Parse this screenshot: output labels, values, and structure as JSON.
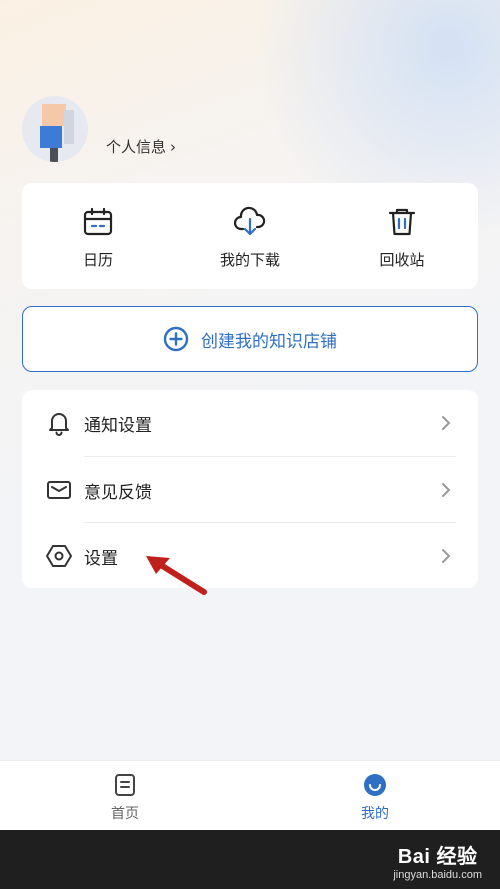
{
  "profile": {
    "info_label": "个人信息",
    "chevron": "›"
  },
  "quick_actions": [
    {
      "label": "日历",
      "icon": "calendar-icon"
    },
    {
      "label": "我的下载",
      "icon": "cloud-download-icon"
    },
    {
      "label": "回收站",
      "icon": "trash-icon"
    }
  ],
  "create_store": {
    "label": "创建我的知识店铺",
    "icon": "plus-circle-icon"
  },
  "settings_list": [
    {
      "label": "通知设置",
      "icon": "bell-icon"
    },
    {
      "label": "意见反馈",
      "icon": "envelope-icon"
    },
    {
      "label": "设置",
      "icon": "hexagon-settings-icon"
    }
  ],
  "tabbar": {
    "items": [
      {
        "label": "首页",
        "icon": "document-icon",
        "active": false
      },
      {
        "label": "我的",
        "icon": "smile-icon",
        "active": true
      }
    ]
  },
  "watermark": {
    "brand": "Bai 经验",
    "site": "jingyan.baidu.com"
  },
  "colors": {
    "accent": "#2f6fc4",
    "text": "#222222",
    "annotation_arrow": "#c0201b"
  }
}
